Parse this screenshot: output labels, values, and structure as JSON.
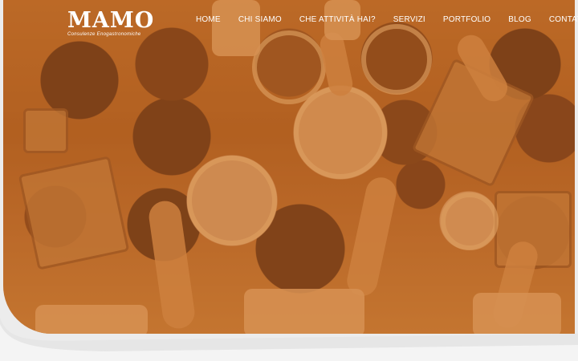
{
  "brand": {
    "name": "MAMO",
    "tagline": "Consulenze Enogastronomiche"
  },
  "nav": {
    "items": [
      "HOME",
      "CHI SIAMO",
      "CHE ATTIVITÀ HAI?",
      "SERVIZI",
      "PORTFOLIO",
      "BLOG",
      "CONTATTI"
    ]
  },
  "hero": {
    "image_subject": "overhead-table-of-food",
    "overlay_color": "#c46e28"
  }
}
